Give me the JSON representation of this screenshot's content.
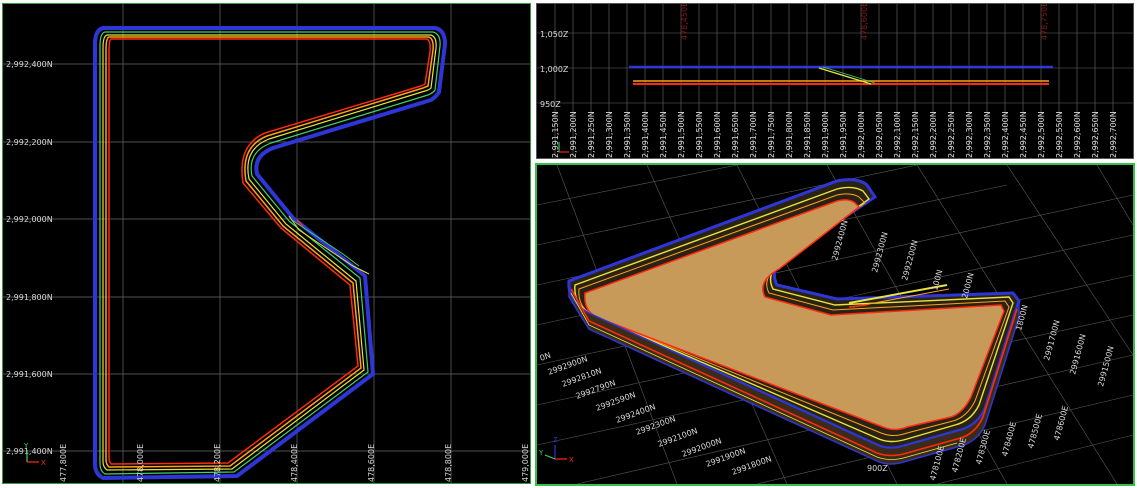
{
  "plan_view": {
    "northing_labels": [
      "2,992,400N",
      "2,992,200N",
      "2,992,000N",
      "2,991,800N",
      "2,991,600N",
      "2,991,400N"
    ],
    "easting_labels": [
      "477,800E",
      "478,000E",
      "478,200E",
      "478,400E",
      "478,600E",
      "478,800E",
      "479,000E"
    ],
    "axis": {
      "y": "Y",
      "x": "X"
    }
  },
  "section_view": {
    "elevation_labels": [
      "1,050Z",
      "1,000Z",
      "950Z"
    ],
    "northing_labels": [
      "2,991,150N",
      "2,991,200N",
      "2,991,250N",
      "2,991,300N",
      "2,991,350N",
      "2,991,400N",
      "2,991,450N",
      "2,991,500N",
      "2,991,550N",
      "2,991,600N",
      "2,991,650N",
      "2,991,700N",
      "2,991,750N",
      "2,991,800N",
      "2,991,850N",
      "2,991,900N",
      "2,991,950N",
      "2,992,000N",
      "2,992,050N",
      "2,992,100N",
      "2,992,150N",
      "2,992,200N",
      "2,992,250N",
      "2,992,300N",
      "2,992,350N",
      "2,992,400N",
      "2,992,450N",
      "2,992,500N",
      "2,992,550N",
      "2,992,600N",
      "2,992,650N",
      "2,992,700N"
    ],
    "top_faint_labels": [
      "478,450E",
      "478,600E",
      "478,750E"
    ]
  },
  "view_3d": {
    "left_labels": [
      "0N",
      "2992900N",
      "2992810N",
      "2992790N",
      "2992590N",
      "2992400N",
      "2992300N",
      "2992100N",
      "2992000N",
      "2991900N",
      "2991800N"
    ],
    "top_labels": [
      "2992400N",
      "2992300N",
      "2992200N",
      "100N",
      "2000N",
      "1800N"
    ],
    "right_labels": [
      "2991700N",
      "2991600N",
      "2991500N"
    ],
    "bottom_right_labels": [
      "478100E",
      "478200E",
      "478300E",
      "478400E",
      "478500E",
      "478600E"
    ],
    "axis": {
      "z": "Z",
      "y": "Y",
      "x": "X"
    },
    "bottom_label": "900Z"
  },
  "colors": {
    "background": "#000000",
    "grid": "#6a6a6a",
    "outline_blue": "#2f36d8",
    "outline_red": "#ff2a10",
    "outline_orange": "#ffa21a",
    "outline_yellow": "#e8e43a",
    "outline_green": "#3fd26a",
    "fill_3d": "#c89a5a",
    "frame_active": "#36c24a"
  }
}
